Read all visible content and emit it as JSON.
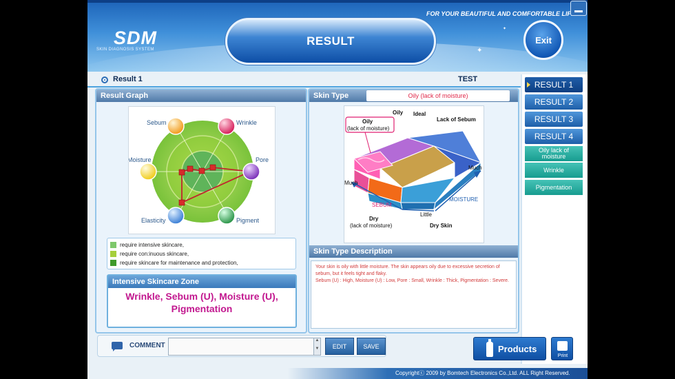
{
  "header": {
    "logo": "SDM",
    "logo_sub": "SKIN DIAGNOSIS SYSTEM",
    "tagline": "FOR YOUR BEAUTIFUL AND COMFORTABLE LIFE",
    "title": "RESULT",
    "exit_label": "Exit"
  },
  "result_label": "Result 1",
  "test_label": "TEST",
  "sidebar": {
    "results": [
      "RESULT 1",
      "RESULT 2",
      "RESULT 3",
      "RESULT 4"
    ],
    "active_index": 0,
    "categories": [
      "Oily lack of moisture",
      "Wrinkle",
      "Pigmentation"
    ]
  },
  "result_graph": {
    "title": "Result Graph",
    "axes": [
      "Sebum",
      "Wrinkle",
      "Pore",
      "Pigment",
      "Elasticity",
      "Moisture"
    ],
    "legend": [
      {
        "color": "#7ec86b",
        "text": "require intensive skincare,"
      },
      {
        "color": "#a5cf3b",
        "text": "require con:inuous skincare,"
      },
      {
        "color": "#3f9a2b",
        "text": "require skincare for maintenance and protection,"
      }
    ]
  },
  "intensive_zone": {
    "title": "Intensive Skincare Zone",
    "text": "Wrinkle, Sebum (U), Moisture (U), Pigmentation"
  },
  "skin_type": {
    "title": "Skin Type",
    "value": "Oily (lack of moisture)",
    "labels": {
      "callout_1": "Oily",
      "callout_2": "(lack of moisture)",
      "oily": "Oily",
      "ideal": "Ideal",
      "lack_sebum": "Lack of Sebum",
      "much_right": "Much",
      "much_left": "Much",
      "sebum": "SEBUM",
      "moisture": "MOISTURE",
      "little": "Little",
      "dry": "Dry",
      "dry_sub": "(lack of moisture)",
      "dry_skin": "Dry Skin"
    }
  },
  "description": {
    "title": "Skin Type Description",
    "line1": "Your skin is oily with little moisture. The skin appears oily due to excessive secretion of sebum, but it feels tight and flaky.",
    "line2": "Sebum (U) : High, Moisture (U) : Low, Pore : Small, Wrinkle : Thick, Pigmentation : Severe."
  },
  "footer": {
    "comment_label": "COMMENT",
    "comment_value": "",
    "edit_label": "EDIT",
    "save_label": "SAVE",
    "products_label": "Products",
    "print_label": "Print",
    "copyright": "Copyrightⓒ 2009 by Bomtech Electronics Co.,Ltd. ALL Right Reserved."
  }
}
